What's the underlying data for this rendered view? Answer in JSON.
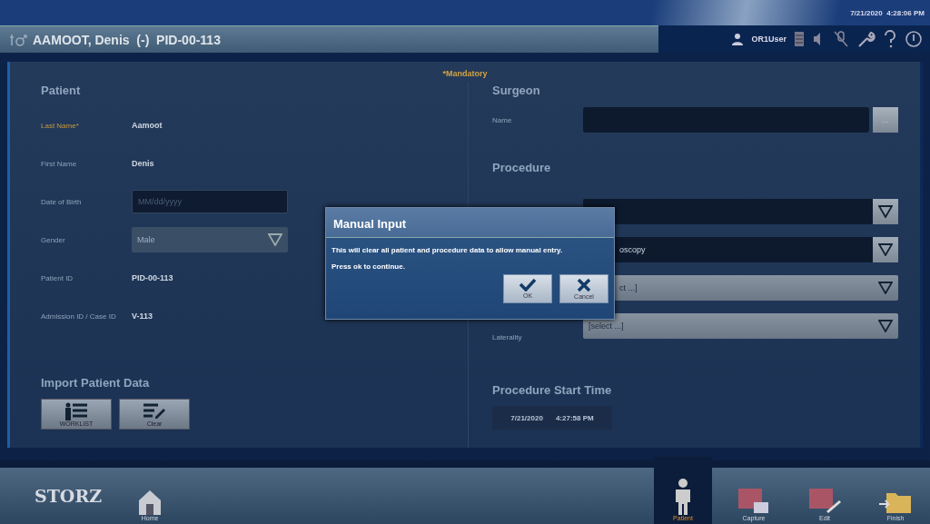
{
  "top_bar": {
    "datetime": "7/21/2020  4:28:06 PM"
  },
  "header": {
    "patient_title": "AAMOOT, Denis  (-)  PID-00-113",
    "user": "OR1User"
  },
  "mandatory_note": "*Mandatory",
  "patient": {
    "heading": "Patient",
    "fields": [
      {
        "label": "Last Name*",
        "kind": "text",
        "value": "Aamoot",
        "required": true
      },
      {
        "label": "First Name",
        "kind": "text",
        "value": "Denis",
        "required": false
      },
      {
        "label": "Date of Birth",
        "kind": "input",
        "placeholder": "MM/dd/yyyy",
        "required": false
      },
      {
        "label": "Gender",
        "kind": "dropdown",
        "value": "Male",
        "required": false,
        "disabled": true
      },
      {
        "label": "Patient ID",
        "kind": "text",
        "value": "PID-00-113",
        "required": false
      },
      {
        "label": "Admission ID / Case ID",
        "kind": "text",
        "value": "V-113",
        "required": false
      }
    ]
  },
  "import": {
    "heading": "Import Patient Data",
    "buttons": [
      {
        "label": "WORKLIST",
        "kind": "worklist"
      },
      {
        "label": "Clear",
        "kind": "clear"
      }
    ]
  },
  "surgeon": {
    "heading": "Surgeon",
    "label": "Name",
    "browse": "..."
  },
  "procedure": {
    "heading": "Procedure",
    "dropdowns": [
      {
        "kind": "dark"
      },
      {
        "kind": "dark",
        "value": "oscopy",
        "hidden_by_dialog": true
      },
      {
        "kind": "light",
        "value": "ct ...]",
        "hidden_by_dialog": true
      },
      {
        "kind": "light",
        "label": "Laterality",
        "value": "[select ...]",
        "hidden_by_dialog": false
      }
    ]
  },
  "start_time": {
    "heading": "Procedure Start Time",
    "date": "7/21/2020",
    "time": "4:27:58 PM"
  },
  "dialog": {
    "title": "Manual Input",
    "lines": [
      "This will clear all patient and procedure data to allow manual entry.",
      "Press ok to continue."
    ],
    "buttons": [
      {
        "label": "OK",
        "kind": "ok"
      },
      {
        "label": "Cancel",
        "kind": "cancel"
      }
    ]
  },
  "nav": {
    "logo": "STORZ",
    "home": "Home",
    "items": [
      {
        "label": "Patient",
        "kind": "patient",
        "selected": true
      },
      {
        "label": "Capture",
        "kind": "capture",
        "selected": false
      },
      {
        "label": "Edit",
        "kind": "edit",
        "selected": false
      },
      {
        "label": "Finish",
        "kind": "finish",
        "selected": false
      }
    ]
  }
}
